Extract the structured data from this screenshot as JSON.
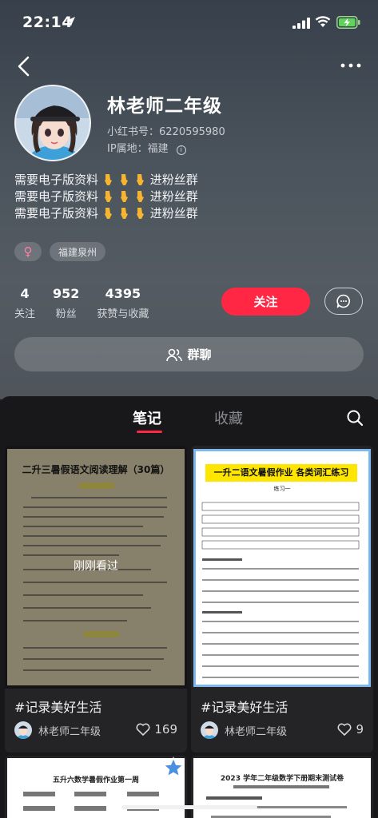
{
  "status_bar": {
    "time": "22:14"
  },
  "profile": {
    "nickname": "林老师二年级",
    "xhs_id": "小红书号：6220595980",
    "ip_location": "IP属地：福建",
    "bio_lines": [
      {
        "text": "需要电子版资料",
        "suffix": "进粉丝群"
      },
      {
        "text": "需要电子版资料",
        "suffix": "进粉丝群"
      },
      {
        "text": "需要电子版资料",
        "suffix": "进粉丝群"
      }
    ],
    "gender_symbol": "♀",
    "region_tag": "福建泉州",
    "stats": [
      {
        "num": "4",
        "label": "关注"
      },
      {
        "num": "952",
        "label": "粉丝"
      },
      {
        "num": "4395",
        "label": "获赞与收藏"
      }
    ],
    "follow_label": "关注",
    "group_chat_label": "群聊"
  },
  "tabs": {
    "notes": "笔记",
    "collections": "收藏"
  },
  "notes": [
    {
      "title": "#记录美好生活",
      "author": "林老师二年级",
      "likes": "169",
      "thumb_title": "二升三暑假语文阅读理解（30篇）",
      "overlay": "刚刚看过"
    },
    {
      "title": "#记录美好生活",
      "author": "林老师二年级",
      "likes": "9",
      "thumb_title": "一升二语文暑假作业 各类词汇练习",
      "thumb_sub": "练习一"
    },
    {
      "thumb_title": "五升六数学暑假作业第一周"
    },
    {
      "thumb_title": "2023 学年二年级数学下册期末测试卷"
    }
  ],
  "colors": {
    "accent": "#ff2744",
    "tab_inactive": "#8a8b8e",
    "background": "#18181a"
  }
}
